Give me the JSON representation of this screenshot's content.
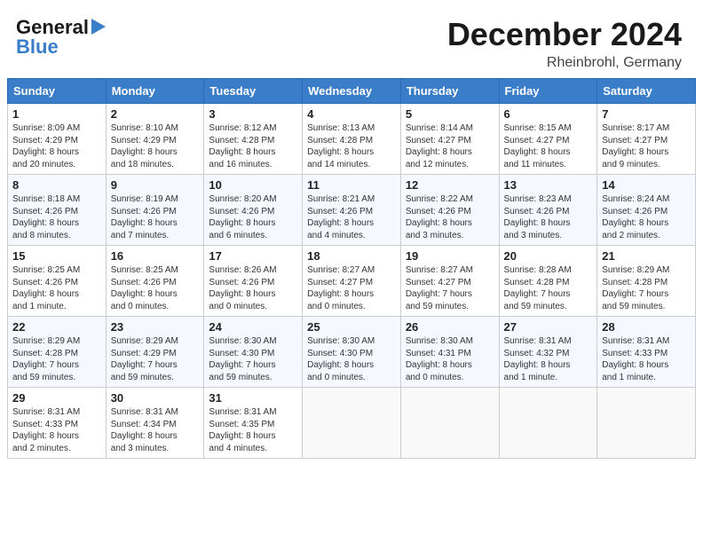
{
  "header": {
    "logo_line1": "General",
    "logo_line2": "Blue",
    "month_year": "December 2024",
    "location": "Rheinbrohl, Germany"
  },
  "weekdays": [
    "Sunday",
    "Monday",
    "Tuesday",
    "Wednesday",
    "Thursday",
    "Friday",
    "Saturday"
  ],
  "weeks": [
    [
      {
        "day": "1",
        "lines": [
          "Sunrise: 8:09 AM",
          "Sunset: 4:29 PM",
          "Daylight: 8 hours",
          "and 20 minutes."
        ]
      },
      {
        "day": "2",
        "lines": [
          "Sunrise: 8:10 AM",
          "Sunset: 4:29 PM",
          "Daylight: 8 hours",
          "and 18 minutes."
        ]
      },
      {
        "day": "3",
        "lines": [
          "Sunrise: 8:12 AM",
          "Sunset: 4:28 PM",
          "Daylight: 8 hours",
          "and 16 minutes."
        ]
      },
      {
        "day": "4",
        "lines": [
          "Sunrise: 8:13 AM",
          "Sunset: 4:28 PM",
          "Daylight: 8 hours",
          "and 14 minutes."
        ]
      },
      {
        "day": "5",
        "lines": [
          "Sunrise: 8:14 AM",
          "Sunset: 4:27 PM",
          "Daylight: 8 hours",
          "and 12 minutes."
        ]
      },
      {
        "day": "6",
        "lines": [
          "Sunrise: 8:15 AM",
          "Sunset: 4:27 PM",
          "Daylight: 8 hours",
          "and 11 minutes."
        ]
      },
      {
        "day": "7",
        "lines": [
          "Sunrise: 8:17 AM",
          "Sunset: 4:27 PM",
          "Daylight: 8 hours",
          "and 9 minutes."
        ]
      }
    ],
    [
      {
        "day": "8",
        "lines": [
          "Sunrise: 8:18 AM",
          "Sunset: 4:26 PM",
          "Daylight: 8 hours",
          "and 8 minutes."
        ]
      },
      {
        "day": "9",
        "lines": [
          "Sunrise: 8:19 AM",
          "Sunset: 4:26 PM",
          "Daylight: 8 hours",
          "and 7 minutes."
        ]
      },
      {
        "day": "10",
        "lines": [
          "Sunrise: 8:20 AM",
          "Sunset: 4:26 PM",
          "Daylight: 8 hours",
          "and 6 minutes."
        ]
      },
      {
        "day": "11",
        "lines": [
          "Sunrise: 8:21 AM",
          "Sunset: 4:26 PM",
          "Daylight: 8 hours",
          "and 4 minutes."
        ]
      },
      {
        "day": "12",
        "lines": [
          "Sunrise: 8:22 AM",
          "Sunset: 4:26 PM",
          "Daylight: 8 hours",
          "and 3 minutes."
        ]
      },
      {
        "day": "13",
        "lines": [
          "Sunrise: 8:23 AM",
          "Sunset: 4:26 PM",
          "Daylight: 8 hours",
          "and 3 minutes."
        ]
      },
      {
        "day": "14",
        "lines": [
          "Sunrise: 8:24 AM",
          "Sunset: 4:26 PM",
          "Daylight: 8 hours",
          "and 2 minutes."
        ]
      }
    ],
    [
      {
        "day": "15",
        "lines": [
          "Sunrise: 8:25 AM",
          "Sunset: 4:26 PM",
          "Daylight: 8 hours",
          "and 1 minute."
        ]
      },
      {
        "day": "16",
        "lines": [
          "Sunrise: 8:25 AM",
          "Sunset: 4:26 PM",
          "Daylight: 8 hours",
          "and 0 minutes."
        ]
      },
      {
        "day": "17",
        "lines": [
          "Sunrise: 8:26 AM",
          "Sunset: 4:26 PM",
          "Daylight: 8 hours",
          "and 0 minutes."
        ]
      },
      {
        "day": "18",
        "lines": [
          "Sunrise: 8:27 AM",
          "Sunset: 4:27 PM",
          "Daylight: 8 hours",
          "and 0 minutes."
        ]
      },
      {
        "day": "19",
        "lines": [
          "Sunrise: 8:27 AM",
          "Sunset: 4:27 PM",
          "Daylight: 7 hours",
          "and 59 minutes."
        ]
      },
      {
        "day": "20",
        "lines": [
          "Sunrise: 8:28 AM",
          "Sunset: 4:28 PM",
          "Daylight: 7 hours",
          "and 59 minutes."
        ]
      },
      {
        "day": "21",
        "lines": [
          "Sunrise: 8:29 AM",
          "Sunset: 4:28 PM",
          "Daylight: 7 hours",
          "and 59 minutes."
        ]
      }
    ],
    [
      {
        "day": "22",
        "lines": [
          "Sunrise: 8:29 AM",
          "Sunset: 4:28 PM",
          "Daylight: 7 hours",
          "and 59 minutes."
        ]
      },
      {
        "day": "23",
        "lines": [
          "Sunrise: 8:29 AM",
          "Sunset: 4:29 PM",
          "Daylight: 7 hours",
          "and 59 minutes."
        ]
      },
      {
        "day": "24",
        "lines": [
          "Sunrise: 8:30 AM",
          "Sunset: 4:30 PM",
          "Daylight: 7 hours",
          "and 59 minutes."
        ]
      },
      {
        "day": "25",
        "lines": [
          "Sunrise: 8:30 AM",
          "Sunset: 4:30 PM",
          "Daylight: 8 hours",
          "and 0 minutes."
        ]
      },
      {
        "day": "26",
        "lines": [
          "Sunrise: 8:30 AM",
          "Sunset: 4:31 PM",
          "Daylight: 8 hours",
          "and 0 minutes."
        ]
      },
      {
        "day": "27",
        "lines": [
          "Sunrise: 8:31 AM",
          "Sunset: 4:32 PM",
          "Daylight: 8 hours",
          "and 1 minute."
        ]
      },
      {
        "day": "28",
        "lines": [
          "Sunrise: 8:31 AM",
          "Sunset: 4:33 PM",
          "Daylight: 8 hours",
          "and 1 minute."
        ]
      }
    ],
    [
      {
        "day": "29",
        "lines": [
          "Sunrise: 8:31 AM",
          "Sunset: 4:33 PM",
          "Daylight: 8 hours",
          "and 2 minutes."
        ]
      },
      {
        "day": "30",
        "lines": [
          "Sunrise: 8:31 AM",
          "Sunset: 4:34 PM",
          "Daylight: 8 hours",
          "and 3 minutes."
        ]
      },
      {
        "day": "31",
        "lines": [
          "Sunrise: 8:31 AM",
          "Sunset: 4:35 PM",
          "Daylight: 8 hours",
          "and 4 minutes."
        ]
      },
      {
        "day": "",
        "lines": []
      },
      {
        "day": "",
        "lines": []
      },
      {
        "day": "",
        "lines": []
      },
      {
        "day": "",
        "lines": []
      }
    ]
  ]
}
